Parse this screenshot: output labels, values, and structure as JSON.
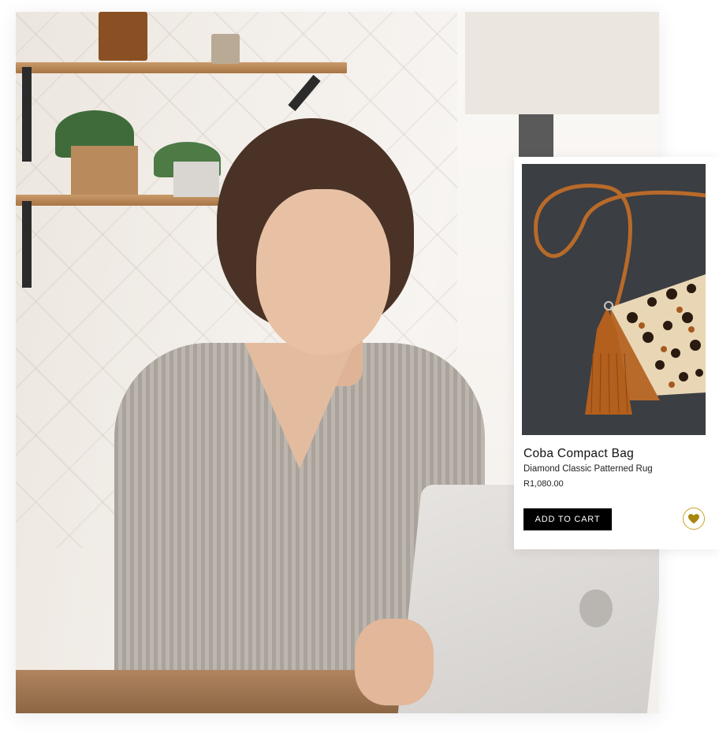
{
  "product": {
    "name": "Coba Compact Bag",
    "subtitle": "Diamond Classic Patterned Rug",
    "price": "R1,080.00",
    "add_to_cart_label": "ADD TO CART",
    "image_icon": "leopard-print-bag-with-tassel"
  },
  "wishlist": {
    "icon": "heart-icon",
    "color": "#a8860f"
  },
  "colors": {
    "button_bg": "#000000",
    "button_text": "#ffffff",
    "accent": "#c9a227"
  },
  "background": {
    "image_icon": "woman-using-laptop-photo"
  }
}
